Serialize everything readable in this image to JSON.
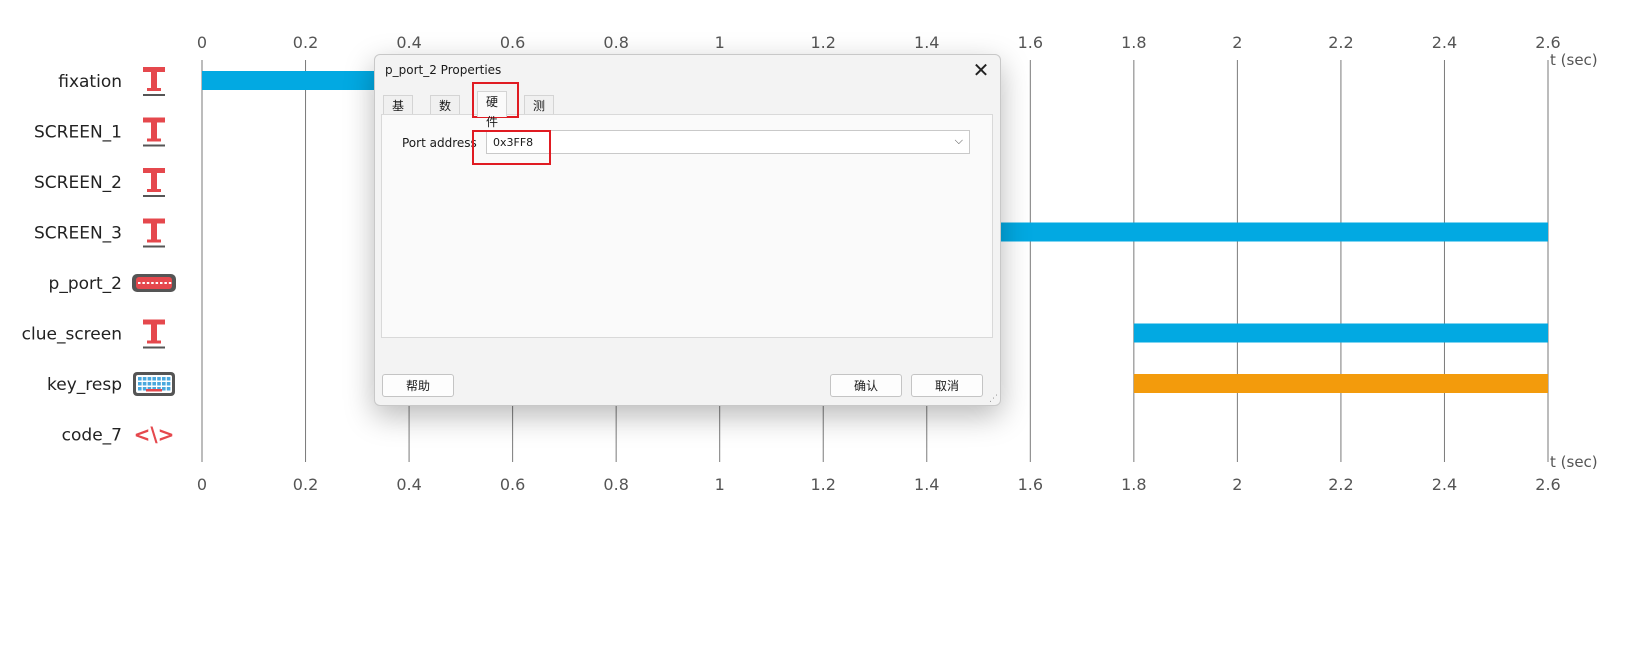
{
  "timeline": {
    "unit_label": "t (sec)",
    "ticks": [
      "0",
      "0.2",
      "0.4",
      "0.6",
      "0.8",
      "1",
      "1.2",
      "1.4",
      "1.6",
      "1.8",
      "2",
      "2.2",
      "2.4",
      "2.6"
    ],
    "rows": [
      {
        "label": "fixation",
        "icon": "text-icon",
        "bars": [
          {
            "start": 0,
            "end": 1.5,
            "color": "#02a9e2"
          }
        ]
      },
      {
        "label": "SCREEN_1",
        "icon": "text-icon",
        "bars": []
      },
      {
        "label": "SCREEN_2",
        "icon": "text-icon",
        "bars": []
      },
      {
        "label": "SCREEN_3",
        "icon": "text-icon",
        "bars": [
          {
            "start": 1.0,
            "end": 2.6,
            "color": "#02a9e2"
          }
        ]
      },
      {
        "label": "p_port_2",
        "icon": "parallel-port-icon",
        "bars": []
      },
      {
        "label": "clue_screen",
        "icon": "text-icon",
        "bars": [
          {
            "start": 1.8,
            "end": 2.6,
            "color": "#02a9e2"
          }
        ]
      },
      {
        "label": "key_resp",
        "icon": "keyboard-icon",
        "bars": [
          {
            "start": 1.8,
            "end": 2.6,
            "color": "#f39b0c"
          }
        ]
      },
      {
        "label": "code_7",
        "icon": "code-icon",
        "bars": []
      }
    ]
  },
  "dialog": {
    "title": "p_port_2 Properties",
    "close_glyph": "✕",
    "tabs": [
      "基础",
      "数据",
      "硬件",
      "测试"
    ],
    "active_tab": "硬件",
    "port_address_label": "Port address",
    "port_address_value": "0x3FF8",
    "chevron_glyph": "⌵",
    "help_label": "帮助",
    "ok_label": "确认",
    "cancel_label": "取消",
    "grip_glyph": "⋰"
  },
  "colors": {
    "stimulus_bar": "#02a9e2",
    "response_bar": "#f39b0c",
    "icon_red": "#e5484d",
    "highlight": "#e01b22"
  }
}
